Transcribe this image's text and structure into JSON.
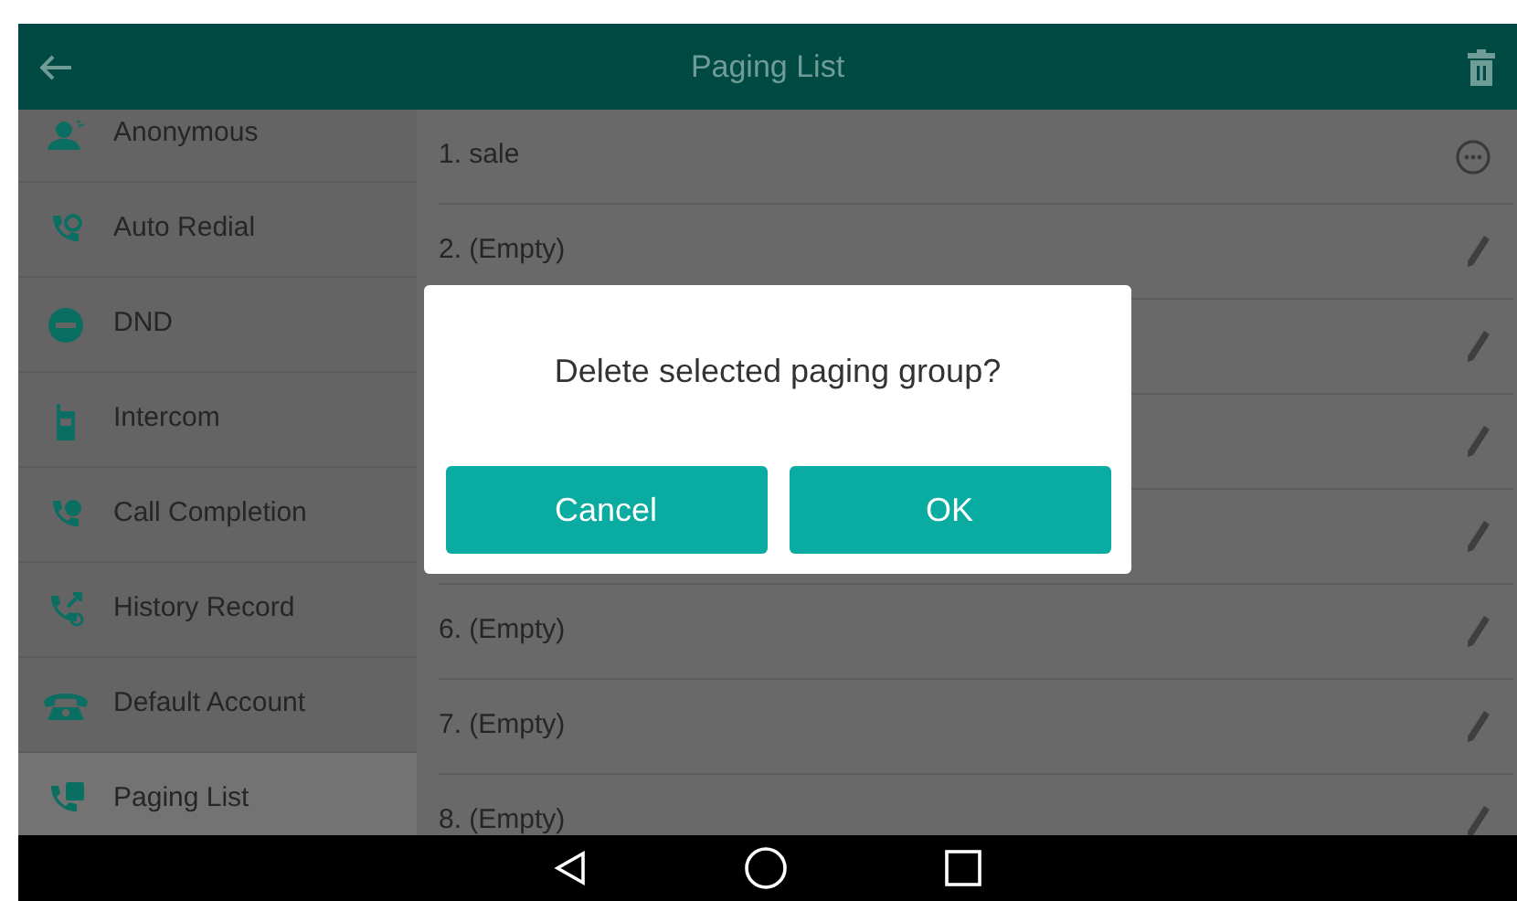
{
  "header": {
    "title": "Paging List"
  },
  "sidebar": {
    "items": [
      {
        "label": "Anonymous",
        "selected": false
      },
      {
        "label": "Auto Redial",
        "selected": false
      },
      {
        "label": "DND",
        "selected": false
      },
      {
        "label": "Intercom",
        "selected": false
      },
      {
        "label": "Call Completion",
        "selected": false
      },
      {
        "label": "History Record",
        "selected": false
      },
      {
        "label": "Default Account",
        "selected": false
      },
      {
        "label": "Paging List",
        "selected": true
      }
    ]
  },
  "list": {
    "rows": [
      {
        "label": "1. sale",
        "kind": "more"
      },
      {
        "label": "2. (Empty)",
        "kind": "edit"
      },
      {
        "kind": "edit"
      },
      {
        "kind": "edit"
      },
      {
        "kind": "edit"
      },
      {
        "label": "6. (Empty)",
        "kind": "edit"
      },
      {
        "label": "7. (Empty)",
        "kind": "edit"
      },
      {
        "label": "8. (Empty)",
        "kind": "edit"
      }
    ]
  },
  "dialog": {
    "message": "Delete selected paging group?",
    "buttons": [
      "Cancel",
      "OK"
    ]
  }
}
